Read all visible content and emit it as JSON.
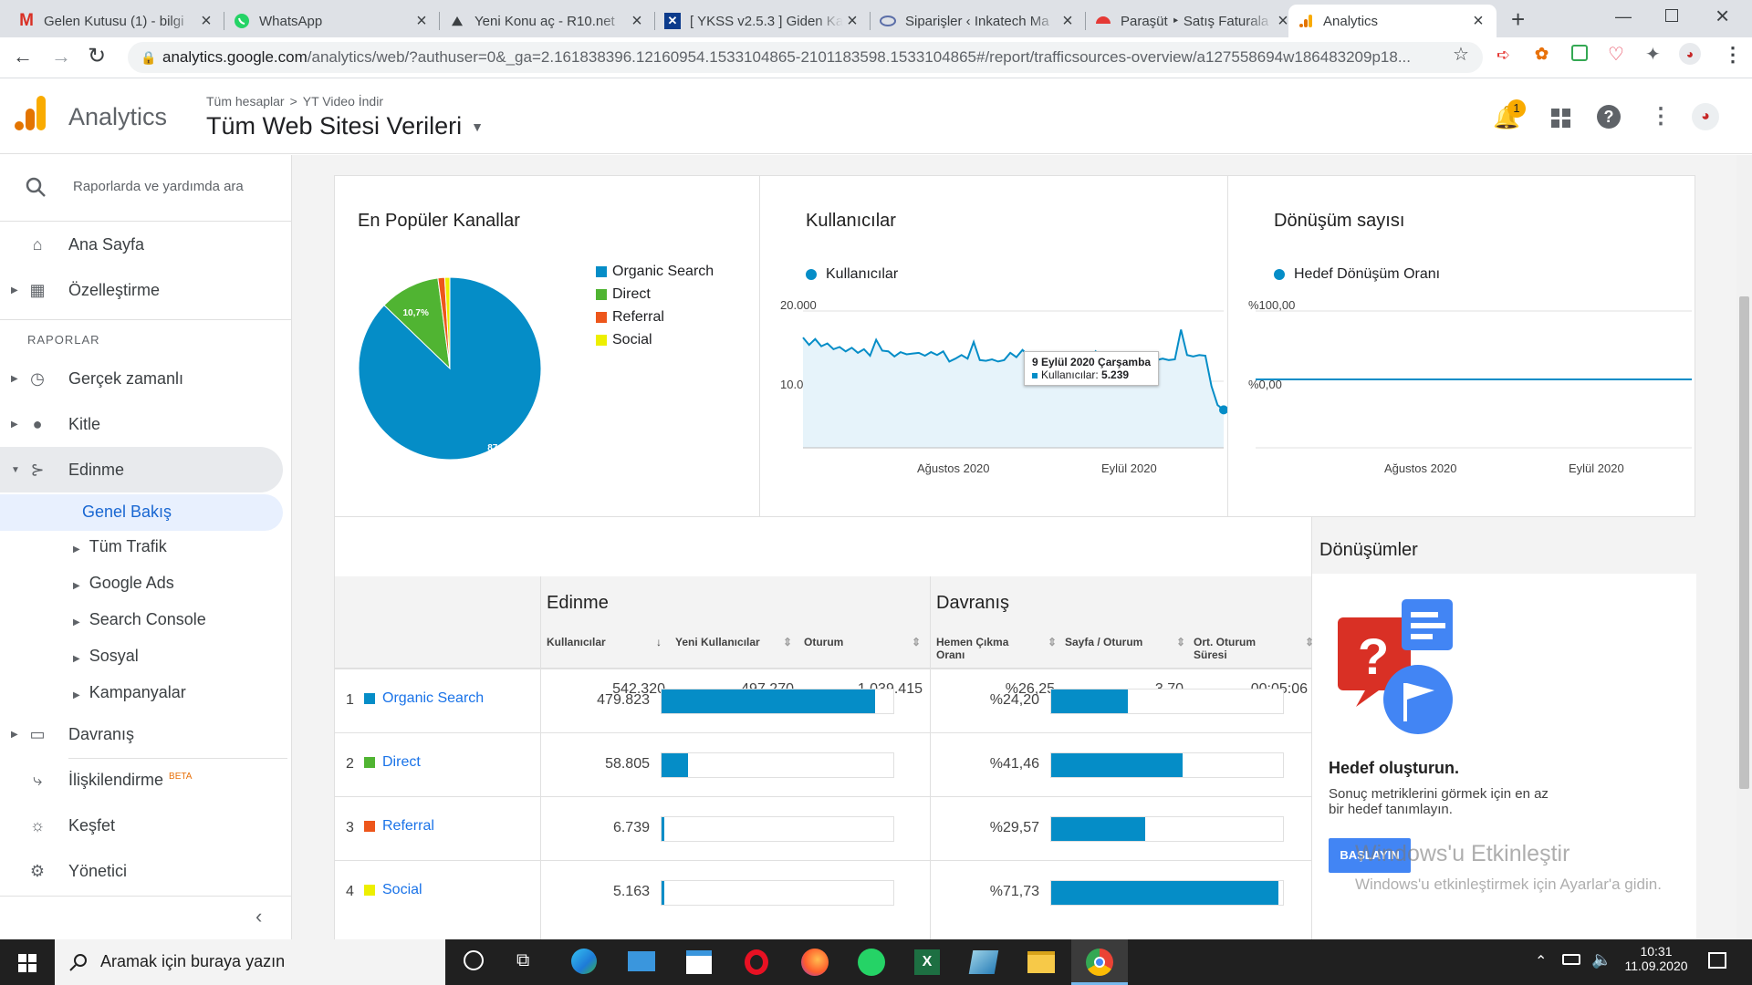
{
  "browser": {
    "tabs": [
      {
        "label": "Gelen Kutusu (1) - bilgi",
        "icon": "gmail-icon",
        "color": "#d93025"
      },
      {
        "label": "WhatsApp",
        "icon": "whatsapp-icon",
        "color": "#25d366"
      },
      {
        "label": "Yeni Konu aç - R10.net",
        "icon": "r10-icon",
        "color": "#333333"
      },
      {
        "label": "[ YKSS v2.5.3 ] Giden Ka",
        "icon": "ykss-icon",
        "color": "#0b3b8c"
      },
      {
        "label": "Siparişler ‹ Inkatech Ma",
        "icon": "wordpress-icon",
        "color": "#5b6ea8"
      },
      {
        "label": "Paraşüt ‣ Satış Faturala",
        "icon": "parasut-icon",
        "color": "#e53935"
      },
      {
        "label": "Analytics",
        "icon": "analytics-icon",
        "color": "#f9ab00"
      }
    ],
    "url_host": "analytics.google.com",
    "url_path": "/analytics/web/?authuser=0&_ga=2.161838396.12160954.1533104865-2101183598.1533104865#/report/trafficsources-overview/a127558694w186483209p18..."
  },
  "header": {
    "logo_text": "Analytics",
    "breadcrumb_root": "Tüm hesaplar",
    "breadcrumb_sep": ">",
    "breadcrumb_account": "YT Video İndir",
    "view_name": "Tüm Web Sitesi Verileri",
    "notif_count": "1"
  },
  "sidebar": {
    "search_placeholder": "Raporlarda ve yardımda ara",
    "home": "Ana Sayfa",
    "customization": "Özelleştirme",
    "reports_heading": "RAPORLAR",
    "realtime": "Gerçek zamanlı",
    "audience": "Kitle",
    "acquisition": "Edinme",
    "overview": "Genel Bakış",
    "all_traffic": "Tüm Trafik",
    "google_ads": "Google Ads",
    "search_console": "Search Console",
    "social": "Sosyal",
    "campaigns": "Kampanyalar",
    "behavior": "Davranış",
    "attribution": "İlişkilendirme",
    "attribution_badge": "BETA",
    "discover": "Keşfet",
    "admin": "Yönetici"
  },
  "channels_card": {
    "title": "En Popüler Kanallar",
    "legend": [
      "Organic Search",
      "Direct",
      "Referral",
      "Social"
    ],
    "slice_labels": [
      "87,2%",
      "10,7%"
    ]
  },
  "users_card": {
    "title": "Kullanıcılar",
    "legend": "Kullanıcılar",
    "y_ticks": [
      "20.000",
      "10.000"
    ],
    "x_ticks": [
      "Ağustos 2020",
      "Eylül 2020"
    ],
    "tooltip_date": "9 Eylül 2020 Çarşamba",
    "tooltip_label": "Kullanıcılar:",
    "tooltip_value": "5.239"
  },
  "conv_card": {
    "title": "Dönüşüm sayısı",
    "legend": "Hedef Dönüşüm Oranı",
    "y_ticks": [
      "%100,00",
      "%0,00"
    ],
    "x_ticks": [
      "Ağustos 2020",
      "Eylül 2020"
    ]
  },
  "table": {
    "group_acq": "Edinme",
    "group_beh": "Davranış",
    "col_users": "Kullanıcılar",
    "col_new": "Yeni Kullanıcılar",
    "col_sessions": "Oturum",
    "col_bounce": "Hemen Çıkma Oranı",
    "col_pps": "Sayfa / Oturum",
    "col_dur": "Ort. Oturum Süresi",
    "totals": {
      "users": "542.320",
      "new": "497.270",
      "sessions": "1.039.415",
      "bounce": "%26,25",
      "pps": "3,70",
      "dur": "00:05:06"
    },
    "rows": [
      {
        "idx": "1",
        "name": "Organic Search",
        "users": "479.823",
        "bounce": "%24,20"
      },
      {
        "idx": "2",
        "name": "Direct",
        "users": "58.805",
        "bounce": "%41,46"
      },
      {
        "idx": "3",
        "name": "Referral",
        "users": "6.739",
        "bounce": "%29,57"
      },
      {
        "idx": "4",
        "name": "Social",
        "users": "5.163",
        "bounce": "%71,73"
      }
    ]
  },
  "conversions_panel": {
    "title": "Dönüşümler",
    "heading": "Hedef oluşturun.",
    "text": "Sonuç metriklerini görmek için en az bir hedef tanımlayın.",
    "button": "BAŞLAYIN"
  },
  "watermark": {
    "line1": "Windows'u Etkinleştir",
    "line2": "Windows'u etkinleştirmek için Ayarlar'a gidin."
  },
  "taskbar": {
    "search": "Aramak için buraya yazın",
    "time": "10:31",
    "date": "11.09.2020"
  },
  "chart_data": [
    {
      "type": "pie",
      "title": "En Popüler Kanallar",
      "categories": [
        "Organic Search",
        "Direct",
        "Referral",
        "Social"
      ],
      "values": [
        87.2,
        10.7,
        1.2,
        0.9
      ],
      "colors": [
        "#058dc7",
        "#50b432",
        "#ed561b",
        "#edef00"
      ]
    },
    {
      "type": "area",
      "title": "Kullanıcılar",
      "ylim": [
        0,
        20000
      ],
      "series": [
        {
          "name": "Kullanıcılar",
          "values": [
            15200,
            14200,
            15000,
            14000,
            14400,
            13600,
            13900,
            13300,
            13800,
            13100,
            13600,
            12700,
            14900,
            13400,
            13300,
            12600,
            13200,
            12900,
            13000,
            13100,
            12700,
            13200,
            12800,
            13300,
            11900,
            12300,
            12800,
            12300,
            14600,
            12100,
            12000,
            12200,
            11900,
            12100,
            13100,
            12500,
            13500,
            12700,
            13000,
            12100,
            13100,
            12200,
            12900,
            11800,
            11700,
            12300,
            11900,
            12100,
            13300,
            12100,
            12800,
            11500,
            12200,
            12600,
            12500,
            12400,
            12200,
            12300,
            12100,
            12300,
            12100,
            12200,
            16300,
            12800,
            12600,
            12800,
            12700,
            8500,
            5900,
            5239
          ]
        }
      ]
    },
    {
      "type": "line",
      "title": "Dönüşüm sayısı",
      "ylim": [
        0,
        100
      ],
      "series": [
        {
          "name": "Hedef Dönüşüm Oranı",
          "values": [
            0,
            0,
            0,
            0,
            0,
            0,
            0,
            0,
            0,
            0
          ]
        }
      ]
    }
  ],
  "colors": {
    "blue": "#058dc7",
    "green": "#50b432",
    "orange": "#ed561b",
    "yellow": "#edef00",
    "link": "#1a73e8",
    "accent": "#e8710a"
  }
}
